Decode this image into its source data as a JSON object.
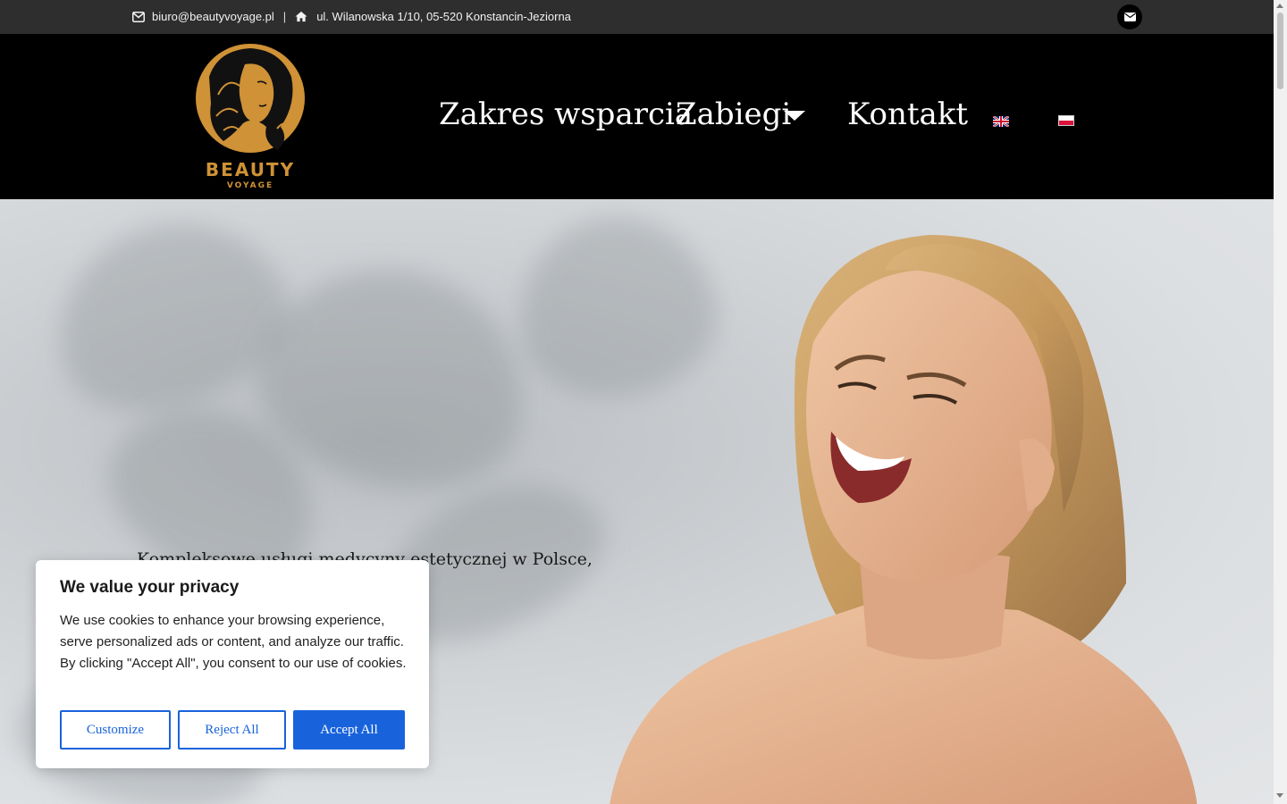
{
  "topbar": {
    "email": "biuro@beautyvoyage.pl",
    "separator": "|",
    "address": "ul. Wilanowska 1/10, 05-520 Konstancin-Jeziorna"
  },
  "logo": {
    "line1": "BEAUTY",
    "line2": "VOYAGE",
    "color": "#cf9236"
  },
  "nav": {
    "items": [
      {
        "label": "Zakres wsparcia"
      },
      {
        "label": "Zabiegi"
      },
      {
        "label": "Kontakt"
      }
    ],
    "languages": [
      "en-flag-icon",
      "pl-flag-icon"
    ]
  },
  "hero": {
    "text": "Kompleksowe usługi medycyny estetycznej w Polsce, Czechach, … ug i bezpieczeństwo"
  },
  "cookie": {
    "title": "We value your privacy",
    "body": "We use cookies to enhance your browsing experience, serve personalized ads or content, and analyze our traffic. By clicking \"Accept All\", you consent to our use of cookies.",
    "customize": "Customize",
    "reject": "Reject All",
    "accept": "Accept All",
    "accent": "#1863dc"
  }
}
